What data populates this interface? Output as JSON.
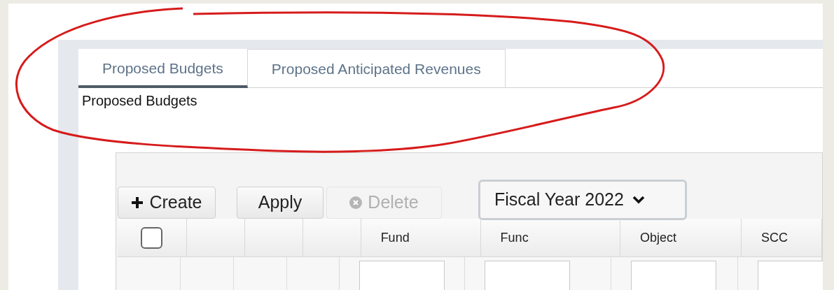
{
  "tabs": [
    {
      "label": "Proposed Budgets",
      "selected": true
    },
    {
      "label": "Proposed Anticipated Revenues",
      "selected": false
    }
  ],
  "section_title": "Proposed Budgets",
  "toolbar": {
    "buttons": [
      {
        "label": "Create",
        "kind": "create",
        "disabled": false
      },
      {
        "label": "Apply",
        "kind": "plain",
        "disabled": false
      },
      {
        "label": "Delete",
        "kind": "delete",
        "disabled": true
      }
    ],
    "fiscal_year_select": {
      "value": "Fiscal Year 2022"
    }
  },
  "table": {
    "select_all": {
      "checked": false
    },
    "columns": [
      {
        "label": "Fund"
      },
      {
        "label": "Func"
      },
      {
        "label": "Object"
      },
      {
        "label": "SCC"
      }
    ]
  }
}
